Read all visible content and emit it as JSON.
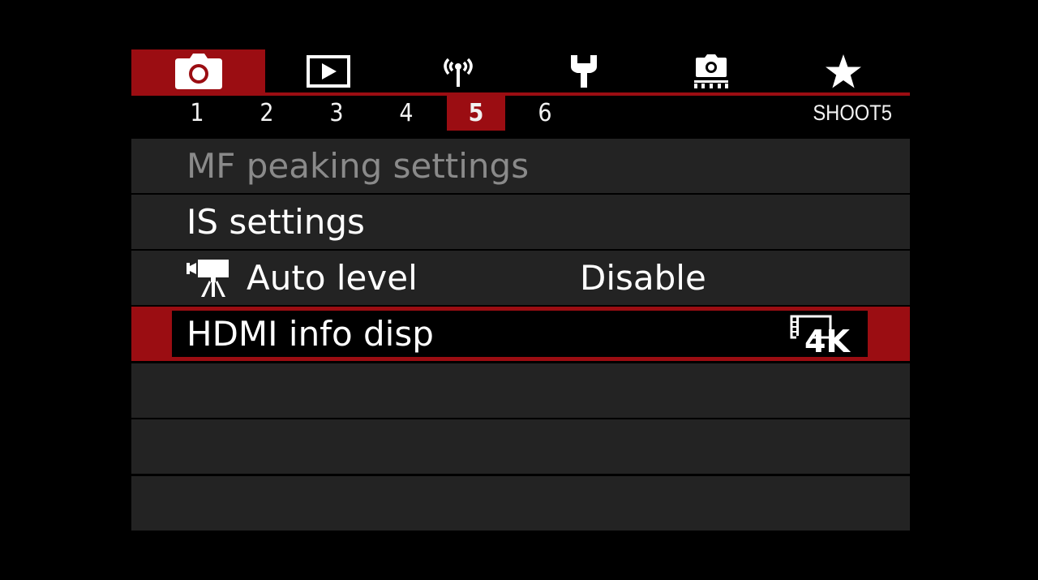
{
  "category_tabs": [
    {
      "icon": "camera-icon",
      "active": true
    },
    {
      "icon": "playback-icon",
      "active": false
    },
    {
      "icon": "wireless-icon",
      "active": false
    },
    {
      "icon": "wrench-icon",
      "active": false
    },
    {
      "icon": "custom-functions-icon",
      "active": false
    },
    {
      "icon": "star-icon",
      "active": false
    }
  ],
  "pages": {
    "numbers": [
      "1",
      "2",
      "3",
      "4",
      "5",
      "6"
    ],
    "active": "5",
    "label": "SHOOT5"
  },
  "menu": [
    {
      "label": "MF peaking settings",
      "value": "",
      "state": "disabled"
    },
    {
      "label": "IS settings",
      "value": "",
      "state": "normal"
    },
    {
      "label": "Auto level",
      "icon": "movie-camera-icon",
      "value": "Disable",
      "state": "normal"
    },
    {
      "label": "HDMI info disp",
      "value_icon": "4k-movie-icon",
      "value_text": "4K",
      "state": "selected"
    }
  ],
  "colors": {
    "accent": "#9b0d12",
    "row_bg": "#232323",
    "background": "#000000",
    "disabled_text": "#8a8a8a"
  }
}
